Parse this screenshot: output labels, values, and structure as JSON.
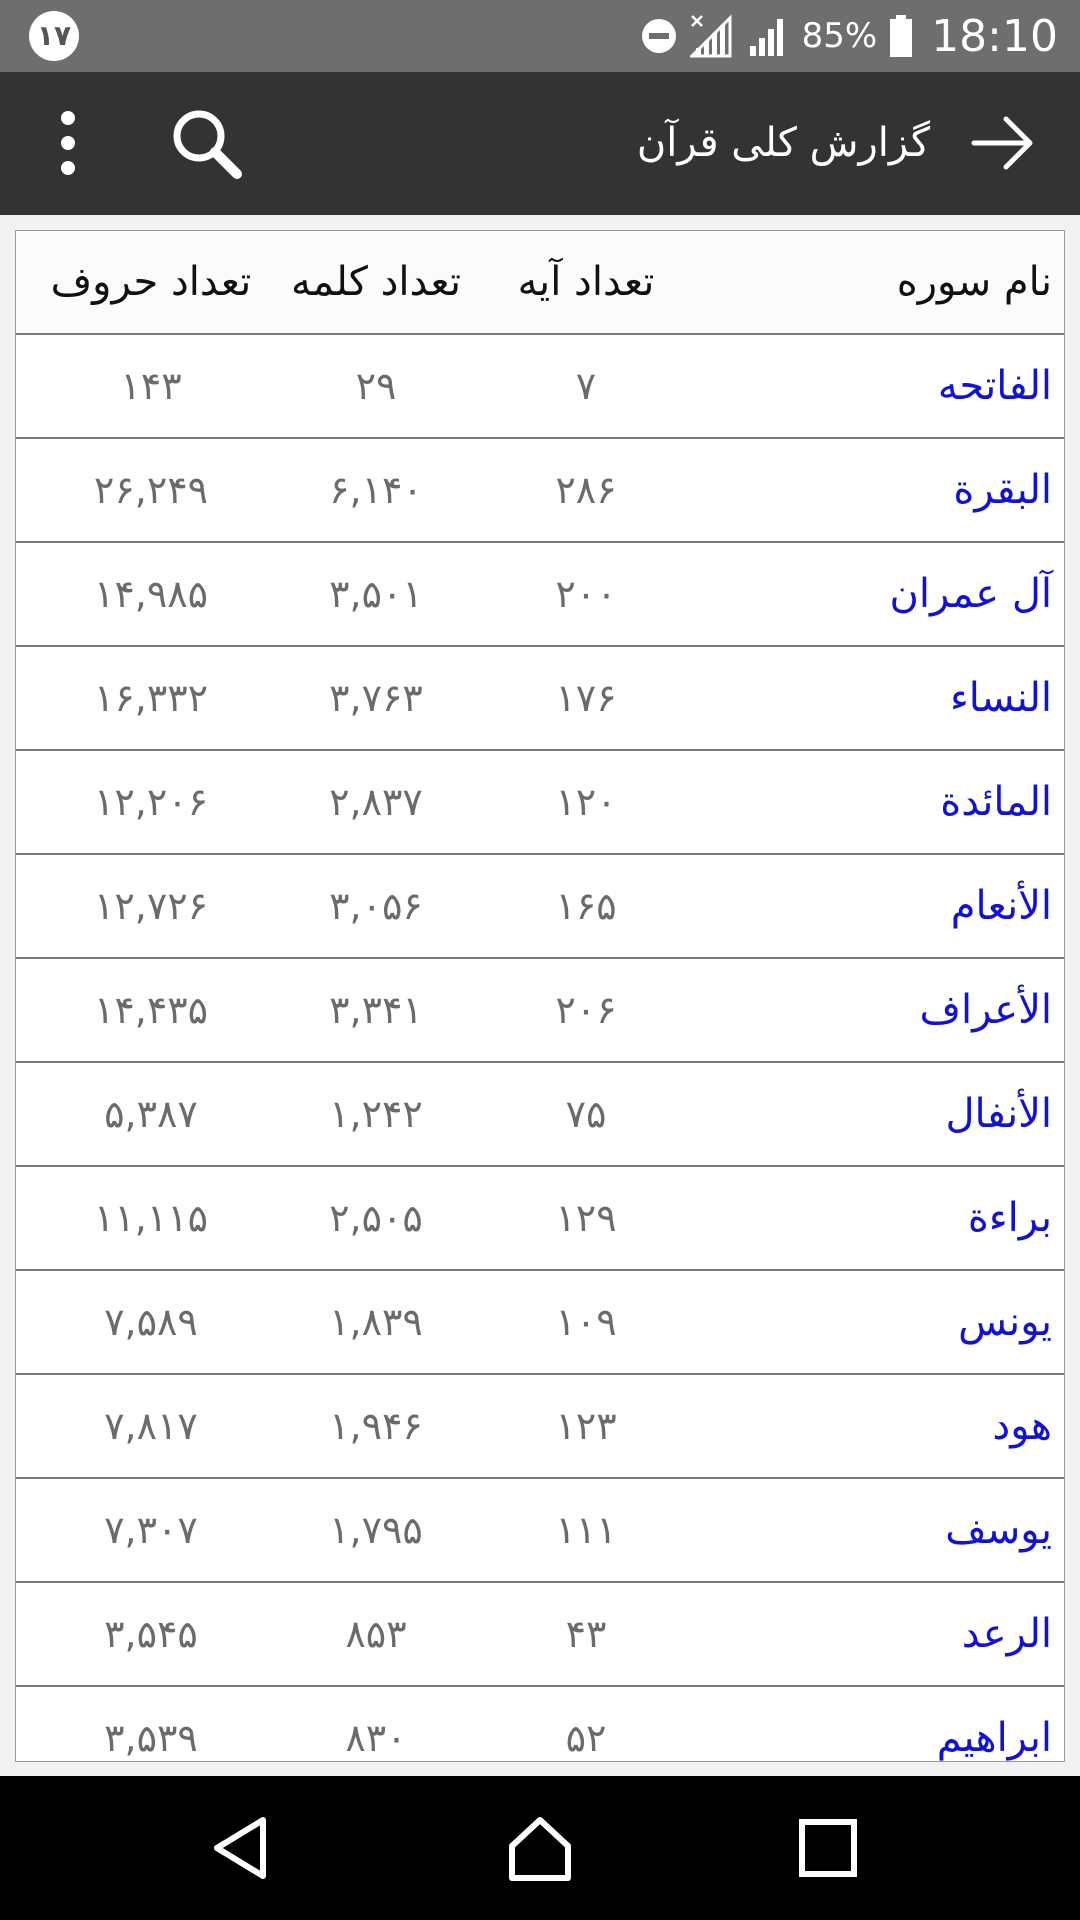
{
  "status_bar": {
    "notification_count": "۱۷",
    "battery_percent": "85%",
    "time": "18:10"
  },
  "app_bar": {
    "title": "گزارش کلی قرآن",
    "icons": {
      "back": "arrow-right-icon",
      "search": "search-icon",
      "more": "more-vert-icon"
    }
  },
  "table": {
    "headers": {
      "name": "نام سوره",
      "verses": "تعداد آیه",
      "words": "تعداد کلمه",
      "letters": "تعداد حروف"
    },
    "rows": [
      {
        "name": "الفاتحه",
        "verses": "۷",
        "words": "۲۹",
        "letters": "۱۴۳"
      },
      {
        "name": "البقرة",
        "verses": "۲۸۶",
        "words": "۶,۱۴۰",
        "letters": "۲۶,۲۴۹"
      },
      {
        "name": "آل عمران",
        "verses": "۲۰۰",
        "words": "۳,۵۰۱",
        "letters": "۱۴,۹۸۵"
      },
      {
        "name": "النساء",
        "verses": "۱۷۶",
        "words": "۳,۷۶۳",
        "letters": "۱۶,۳۳۲"
      },
      {
        "name": "المائدة",
        "verses": "۱۲۰",
        "words": "۲,۸۳۷",
        "letters": "۱۲,۲۰۶"
      },
      {
        "name": "الأنعام",
        "verses": "۱۶۵",
        "words": "۳,۰۵۶",
        "letters": "۱۲,۷۲۶"
      },
      {
        "name": "الأعراف",
        "verses": "۲۰۶",
        "words": "۳,۳۴۱",
        "letters": "۱۴,۴۳۵"
      },
      {
        "name": "الأنفال",
        "verses": "۷۵",
        "words": "۱,۲۴۲",
        "letters": "۵,۳۸۷"
      },
      {
        "name": "براءة",
        "verses": "۱۲۹",
        "words": "۲,۵۰۵",
        "letters": "۱۱,۱۱۵"
      },
      {
        "name": "یونس",
        "verses": "۱۰۹",
        "words": "۱,۸۳۹",
        "letters": "۷,۵۸۹"
      },
      {
        "name": "هود",
        "verses": "۱۲۳",
        "words": "۱,۹۴۶",
        "letters": "۷,۸۱۷"
      },
      {
        "name": "یوسف",
        "verses": "۱۱۱",
        "words": "۱,۷۹۵",
        "letters": "۷,۳۰۷"
      },
      {
        "name": "الرعد",
        "verses": "۴۳",
        "words": "۸۵۳",
        "letters": "۳,۵۴۵"
      },
      {
        "name": "ابراهیم",
        "verses": "۵۲",
        "words": "۸۳۰",
        "letters": "۳,۵۳۹"
      }
    ]
  },
  "nav_bar": {
    "icons": {
      "back": "nav-back-icon",
      "home": "nav-home-icon",
      "recents": "nav-recents-icon"
    }
  },
  "colors": {
    "status_bar": "#6e6e6e",
    "app_bar": "#333333",
    "surah_name": "#1212d6",
    "number_text": "#6b6b6b",
    "nav_bar": "#000000"
  }
}
